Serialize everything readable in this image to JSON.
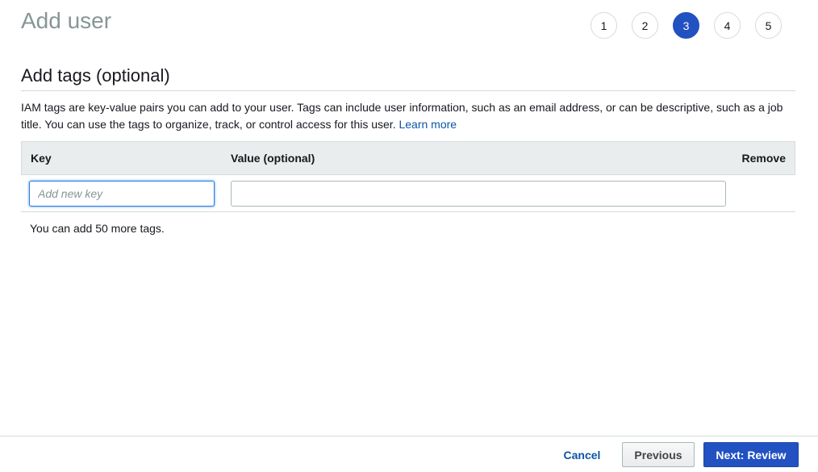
{
  "page": {
    "title": "Add user"
  },
  "steps": {
    "items": [
      "1",
      "2",
      "3",
      "4",
      "5"
    ],
    "active": "3"
  },
  "section": {
    "title": "Add tags (optional)",
    "description": "IAM tags are key-value pairs you can add to your user. Tags can include user information, such as an email address, or can be descriptive, such as a job title. You can use the tags to organize, track, or control access for this user.",
    "learn_more": "Learn more"
  },
  "table": {
    "headers": {
      "key": "Key",
      "value": "Value (optional)",
      "remove": "Remove"
    },
    "row": {
      "key_placeholder": "Add new key",
      "key_value": "",
      "value_value": ""
    }
  },
  "tags_remaining": "You can add 50 more tags.",
  "footer": {
    "cancel": "Cancel",
    "previous": "Previous",
    "next": "Next: Review"
  },
  "colors": {
    "accent": "#2251c1",
    "link": "#0d55a6",
    "title_gray": "#879596"
  }
}
